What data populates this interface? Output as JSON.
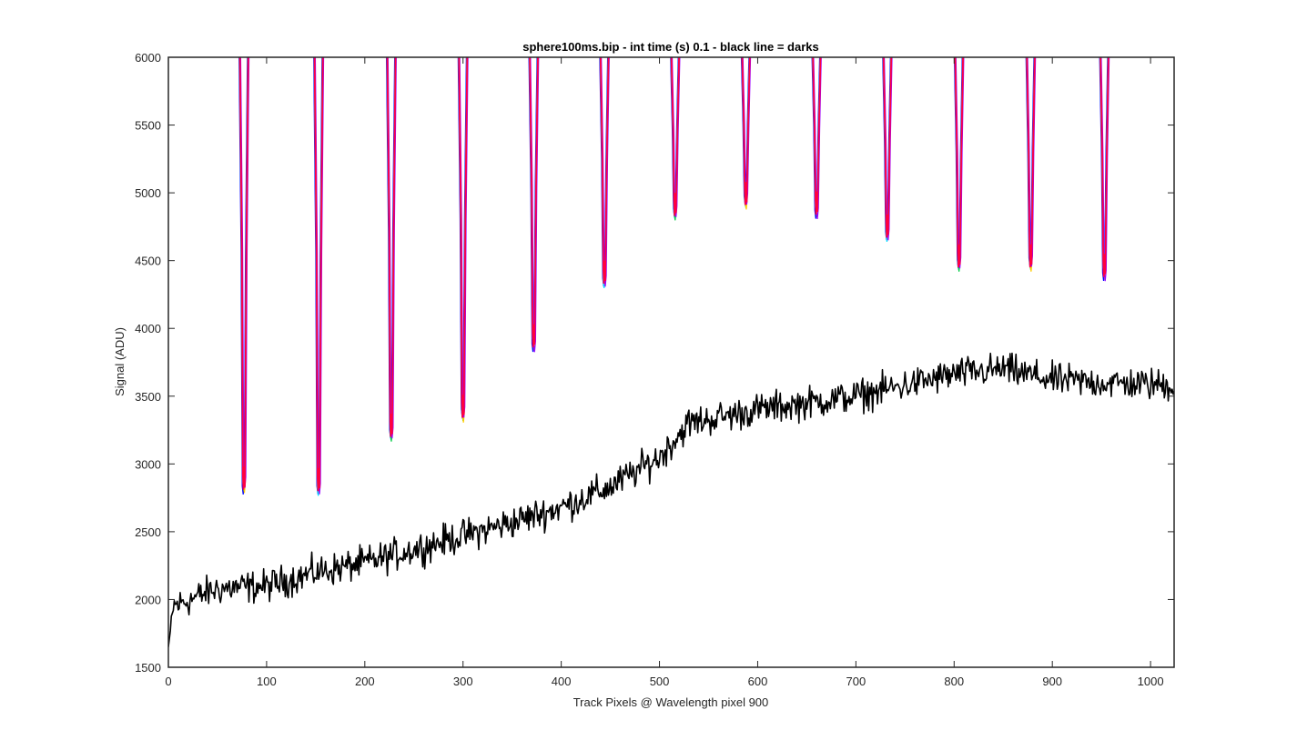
{
  "chart_data": {
    "type": "line",
    "title": "sphere100ms.bip - int time (s) 0.1 - black line = darks",
    "xlabel": "Track Pixels @ Wavelength pixel 900",
    "ylabel": "Signal (ADU)",
    "xlim": [
      0,
      1024
    ],
    "ylim": [
      1500,
      6000
    ],
    "xticks": [
      0,
      100,
      200,
      300,
      400,
      500,
      600,
      700,
      800,
      900,
      1000
    ],
    "yticks": [
      1500,
      2000,
      2500,
      3000,
      3500,
      4000,
      4500,
      5000,
      5500,
      6000
    ],
    "grid": false,
    "box": true,
    "colors": {
      "sphere_line": "#ff0040",
      "dark_line": "#000000",
      "axis": "#262626",
      "dip_tip_colors": [
        "#0000ff",
        "#00e0ff",
        "#00cc44",
        "#ffcc00",
        "#9900ff"
      ]
    },
    "series": [
      {
        "role": "sphere (saturated above 6000 except at track gaps)",
        "color": "#ff0040",
        "dips": [
          {
            "x": 77,
            "min": 2800
          },
          {
            "x": 153,
            "min": 2790
          },
          {
            "x": 227,
            "min": 3190
          },
          {
            "x": 300,
            "min": 3330
          },
          {
            "x": 372,
            "min": 3850
          },
          {
            "x": 444,
            "min": 4320
          },
          {
            "x": 516,
            "min": 4820
          },
          {
            "x": 588,
            "min": 4900
          },
          {
            "x": 660,
            "min": 4830
          },
          {
            "x": 732,
            "min": 4660
          },
          {
            "x": 805,
            "min": 4440
          },
          {
            "x": 878,
            "min": 4440
          },
          {
            "x": 953,
            "min": 4370
          }
        ]
      },
      {
        "role": "darks",
        "color": "#000000",
        "trend": [
          {
            "x": 0,
            "y": 1650
          },
          {
            "x": 5,
            "y": 1950
          },
          {
            "x": 50,
            "y": 2080
          },
          {
            "x": 100,
            "y": 2100
          },
          {
            "x": 150,
            "y": 2200
          },
          {
            "x": 200,
            "y": 2270
          },
          {
            "x": 250,
            "y": 2370
          },
          {
            "x": 300,
            "y": 2470
          },
          {
            "x": 350,
            "y": 2570
          },
          {
            "x": 400,
            "y": 2680
          },
          {
            "x": 450,
            "y": 2830
          },
          {
            "x": 500,
            "y": 3050
          },
          {
            "x": 530,
            "y": 3300
          },
          {
            "x": 600,
            "y": 3400
          },
          {
            "x": 650,
            "y": 3450
          },
          {
            "x": 700,
            "y": 3500
          },
          {
            "x": 750,
            "y": 3580
          },
          {
            "x": 800,
            "y": 3660
          },
          {
            "x": 850,
            "y": 3700
          },
          {
            "x": 900,
            "y": 3620
          },
          {
            "x": 950,
            "y": 3600
          },
          {
            "x": 1024,
            "y": 3580
          }
        ],
        "noise_amplitude": 110
      }
    ]
  }
}
